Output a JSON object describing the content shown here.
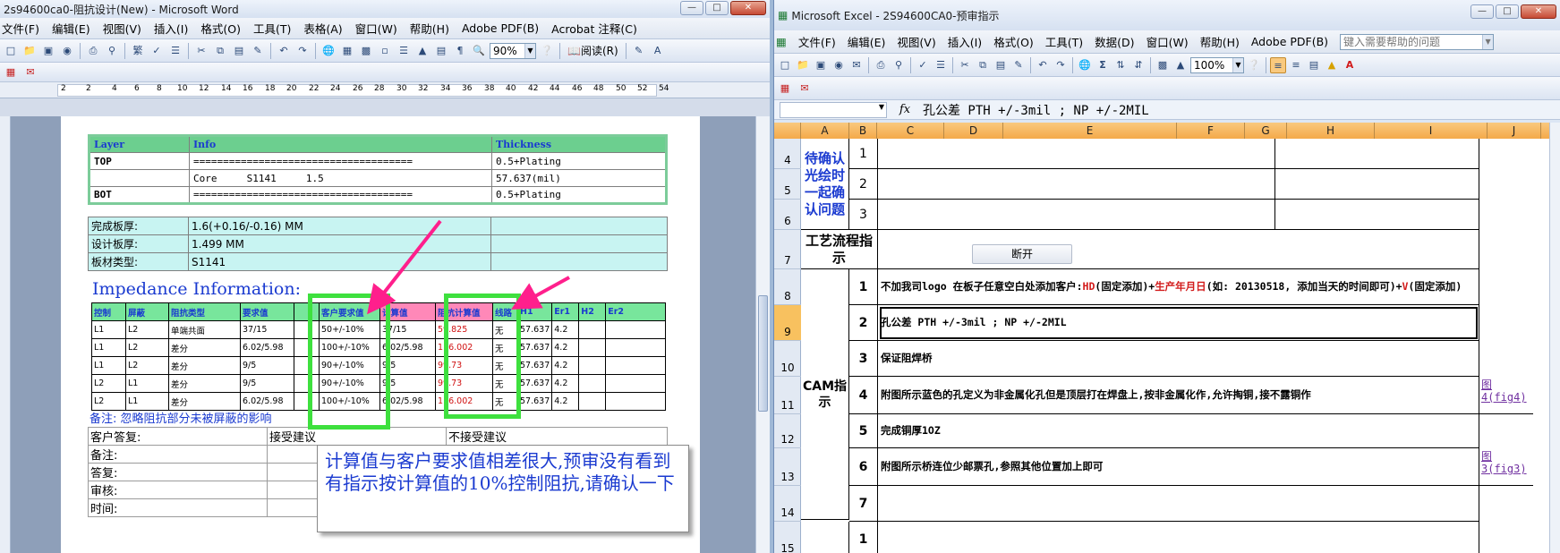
{
  "word": {
    "title": "2s94600ca0-阻抗设计(New) - Microsoft Word",
    "menu": [
      "文件(F)",
      "编辑(E)",
      "视图(V)",
      "插入(I)",
      "格式(O)",
      "工具(T)",
      "表格(A)",
      "窗口(W)",
      "帮助(H)",
      "Adobe PDF(B)",
      "Acrobat 注释(C)"
    ],
    "zoom": "90%",
    "read_label": "阅读(R)",
    "ruler_ticks": [
      "2",
      "2",
      "4",
      "6",
      "8",
      "10",
      "12",
      "14",
      "16",
      "18",
      "20",
      "22",
      "24",
      "26",
      "28",
      "30",
      "32",
      "34",
      "36",
      "38",
      "40",
      "42",
      "44",
      "46",
      "48",
      "50",
      "52",
      "54"
    ],
    "layer_table": {
      "headers": [
        "Layer",
        "Info",
        "Thickness"
      ],
      "rows": [
        [
          "TOP",
          "=====================================",
          "0.5+Plating"
        ],
        [
          "",
          "Core     S1141     1.5",
          "57.637(mil)"
        ],
        [
          "BOT",
          "=====================================",
          "0.5+Plating"
        ]
      ]
    },
    "board_table": [
      [
        "完成板厚:",
        "1.6(+0.16/-0.16) MM",
        ""
      ],
      [
        "设计板厚:",
        "1.499 MM",
        ""
      ],
      [
        "板材类型:",
        "S1141",
        ""
      ]
    ],
    "impedance_title": "Impedance Information:",
    "imp_table": {
      "headers": [
        "控制",
        "屏蔽",
        "阻抗类型",
        "要求值",
        "",
        "客户要求值",
        "计算值",
        "阻抗计算值",
        "线路",
        "H1",
        "Er1",
        "H2",
        "Er2"
      ],
      "rows": [
        [
          "L1",
          "L2",
          "单端共面",
          "37/15",
          "",
          "50+/-10%",
          "37/15",
          "59.825",
          "无",
          "57.637",
          "4.2",
          "",
          ""
        ],
        [
          "L1",
          "L2",
          "差分",
          "6.02/5.98",
          "",
          "100+/-10%",
          "6.02/5.98",
          "116.002",
          "无",
          "57.637",
          "4.2",
          "",
          ""
        ],
        [
          "L1",
          "L2",
          "差分",
          "9/5",
          "",
          "90+/-10%",
          "9/5",
          "99.73",
          "无",
          "57.637",
          "4.2",
          "",
          ""
        ],
        [
          "L2",
          "L1",
          "差分",
          "9/5",
          "",
          "90+/-10%",
          "9/5",
          "99.73",
          "无",
          "57.637",
          "4.2",
          "",
          ""
        ],
        [
          "L2",
          "L1",
          "差分",
          "6.02/5.98",
          "",
          "100+/-10%",
          "6.02/5.98",
          "116.002",
          "无",
          "57.637",
          "4.2",
          "",
          ""
        ]
      ]
    },
    "note": "备注: 忽略阻抗部分未被屏蔽的影响",
    "sign_rows": [
      [
        "客户答复:",
        "接受建议",
        "不接受建议"
      ],
      [
        "备注:",
        "",
        ""
      ],
      [
        "答复:",
        "",
        ""
      ],
      [
        "审核:",
        "",
        ""
      ],
      [
        "时间:",
        "",
        ""
      ]
    ],
    "callout": "计算值与客户要求值相差很大,预审没有看到有指示按计算值的10%控制阻抗,请确认一下"
  },
  "excel": {
    "title": "Microsoft Excel - 2S94600CA0-预审指示",
    "menu": [
      "文件(F)",
      "编辑(E)",
      "视图(V)",
      "插入(I)",
      "格式(O)",
      "工具(T)",
      "数据(D)",
      "窗口(W)",
      "帮助(H)",
      "Adobe PDF(B)"
    ],
    "help_placeholder": "键入需要帮助的问题",
    "zoom": "100%",
    "formula": "孔公差 PTH +/-3mil ;  NP +/-2MIL",
    "columns": [
      "A",
      "B",
      "C",
      "D",
      "E",
      "F",
      "G",
      "H",
      "I",
      "J"
    ],
    "row_numbers": [
      "4",
      "5",
      "6",
      "7",
      "8",
      "9",
      "10",
      "11",
      "12",
      "13",
      "14",
      "15"
    ],
    "confirm_label": "待确认光绘时一起确认问题",
    "process_label": "工艺流程指示",
    "button_label": "断开",
    "cam_label": "CAM指示",
    "confirm_nums": [
      "1",
      "2",
      "3"
    ],
    "cam_items": [
      {
        "num": "1",
        "text_parts": [
          "不加我司logo 在板子任意空白处添加客户:",
          "HD",
          "(固定添加)+",
          "生产年月日",
          "(如: 20130518, 添加当天的时间即可)+",
          "V",
          "(固定添加)"
        ]
      },
      {
        "num": "2",
        "text": "孔公差 PTH +/-3mil ;  NP +/-2MIL"
      },
      {
        "num": "3",
        "text": "保证阻焊桥"
      },
      {
        "num": "4",
        "text": "附图所示蓝色的孔定义为非金属化孔但是顶层打在焊盘上,按非金属化作,允许掏铜,接不露铜作",
        "link": "图4(fig4)"
      },
      {
        "num": "5",
        "text": "完成铜厚1OZ"
      },
      {
        "num": "6",
        "text": "附图所示桥连位少邮票孔,参照其他位置加上即可",
        "link": "图3(fig3)"
      },
      {
        "num": "7",
        "text": ""
      }
    ],
    "next_num": "1",
    "colors": {
      "red": "#d21b1b",
      "blue": "#1a3ad0",
      "header_orange": "#f4a94a"
    }
  }
}
